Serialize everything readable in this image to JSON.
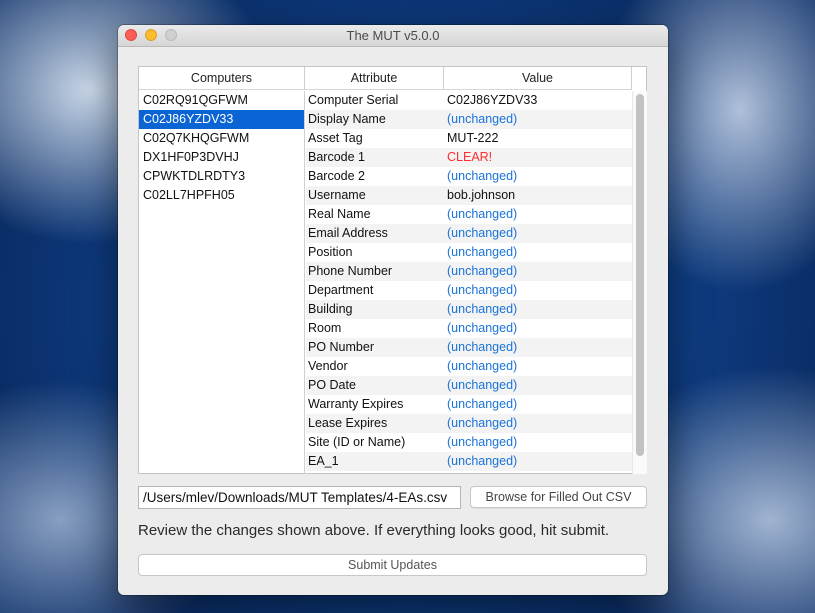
{
  "window": {
    "title": "The MUT v5.0.0"
  },
  "computers": {
    "header": "Computers",
    "items": [
      {
        "serial": "C02RQ91QGFWM",
        "selected": false
      },
      {
        "serial": "C02J86YZDV33",
        "selected": true
      },
      {
        "serial": "C02Q7KHQGFWM",
        "selected": false
      },
      {
        "serial": "DX1HF0P3DVHJ",
        "selected": false
      },
      {
        "serial": "CPWKTDLRDTY3",
        "selected": false
      },
      {
        "serial": "C02LL7HPFH05",
        "selected": false
      }
    ]
  },
  "attributes": {
    "header_attribute": "Attribute",
    "header_value": "Value",
    "rows": [
      {
        "attribute": "Computer Serial",
        "value": "C02J86YZDV33",
        "state": "normal"
      },
      {
        "attribute": "Display Name",
        "value": "(unchanged)",
        "state": "unchanged"
      },
      {
        "attribute": "Asset Tag",
        "value": "MUT-222",
        "state": "normal"
      },
      {
        "attribute": "Barcode 1",
        "value": "CLEAR!",
        "state": "clear"
      },
      {
        "attribute": "Barcode 2",
        "value": "(unchanged)",
        "state": "unchanged"
      },
      {
        "attribute": "Username",
        "value": "bob.johnson",
        "state": "normal"
      },
      {
        "attribute": "Real Name",
        "value": "(unchanged)",
        "state": "unchanged"
      },
      {
        "attribute": "Email Address",
        "value": "(unchanged)",
        "state": "unchanged"
      },
      {
        "attribute": "Position",
        "value": "(unchanged)",
        "state": "unchanged"
      },
      {
        "attribute": "Phone Number",
        "value": "(unchanged)",
        "state": "unchanged"
      },
      {
        "attribute": "Department",
        "value": "(unchanged)",
        "state": "unchanged"
      },
      {
        "attribute": "Building",
        "value": "(unchanged)",
        "state": "unchanged"
      },
      {
        "attribute": "Room",
        "value": "(unchanged)",
        "state": "unchanged"
      },
      {
        "attribute": "PO Number",
        "value": "(unchanged)",
        "state": "unchanged"
      },
      {
        "attribute": "Vendor",
        "value": "(unchanged)",
        "state": "unchanged"
      },
      {
        "attribute": "PO Date",
        "value": "(unchanged)",
        "state": "unchanged"
      },
      {
        "attribute": "Warranty Expires",
        "value": "(unchanged)",
        "state": "unchanged"
      },
      {
        "attribute": "Lease Expires",
        "value": "(unchanged)",
        "state": "unchanged"
      },
      {
        "attribute": "Site (ID or Name)",
        "value": "(unchanged)",
        "state": "unchanged"
      },
      {
        "attribute": "EA_1",
        "value": "(unchanged)",
        "state": "unchanged"
      }
    ]
  },
  "csv": {
    "path": "/Users/mlev/Downloads/MUT Templates/4-EAs.csv",
    "browse_label": "Browse for Filled Out CSV"
  },
  "instructions": "Review the changes shown above. If everything looks good, hit submit.",
  "submit_label": "Submit Updates",
  "colors": {
    "selection": "#0b64d3",
    "unchanged": "#1a73d8",
    "clear": "#ff2d2d"
  }
}
